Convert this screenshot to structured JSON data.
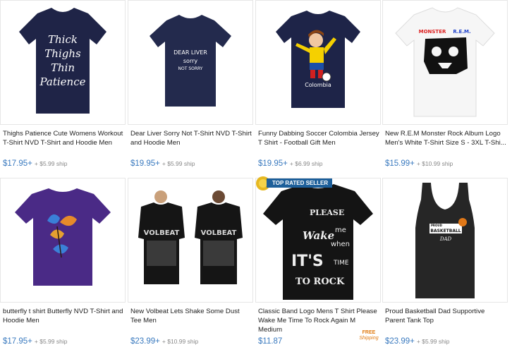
{
  "products": [
    {
      "title": "Thighs Patience Cute Womens Workout T-Shirt NVD T-Shirt and Hoodie Men",
      "price": "$17.95+",
      "ship": "+ $5.99 ship",
      "image_text": [
        "Thick",
        "Thighs",
        "Thin",
        "Patience"
      ]
    },
    {
      "title": "Dear Liver Sorry Not T-Shirt NVD T-Shirt and Hoodie Men",
      "price": "$19.95+",
      "ship": "+ $5.99 ship",
      "image_text": [
        "DEAR LIVER",
        "sorry",
        "NOT SORRY"
      ]
    },
    {
      "title": "Funny Dabbing Soccer Colombia Jersey T Shirt - Football Gift Men",
      "price": "$19.95+",
      "ship": "+ $6.99 ship",
      "image_text": [
        "Colombia"
      ]
    },
    {
      "title": "New R.E.M Monster Rock Album Logo Men's White T-Shirt Size S - 3XL T-Shi...",
      "price": "$15.99+",
      "ship": "+ $10.99 ship",
      "image_text": [
        "MONSTER",
        "R.E.M."
      ]
    },
    {
      "title": "butterfly t shirt Butterfly NVD T-Shirt and Hoodie Men",
      "price": "$17.95+",
      "ship": "+ $5.99 ship",
      "image_text": []
    },
    {
      "title": "New Volbeat Lets Shake Some Dust Tee Men",
      "price": "$23.99+",
      "ship": "+ $10.99 ship",
      "image_text": [
        "VOLBEAT",
        "VOLBEAT"
      ]
    },
    {
      "title": "Classic Band Logo Mens T Shirt Please Wake Me Time To Rock Again M Medium",
      "price": "$11.87",
      "ship": "",
      "badge": "TOP RATED SELLER",
      "free_shipping": {
        "line1": "FREE",
        "line2": "Shipping"
      },
      "image_text": [
        "PLEASE",
        "Wake",
        "me",
        "when",
        "IT'S",
        "TIME",
        "TO ROCK"
      ]
    },
    {
      "title": "Proud Basketball Dad Supportive Parent Tank Top",
      "price": "$23.99+",
      "ship": "+ $5.99 ship",
      "image_text": [
        "PROUD",
        "BASKETBALL",
        "DAD"
      ]
    }
  ],
  "colors": {
    "price": "#3a7abf",
    "ship": "#888888",
    "badge": "#1d5f9a"
  }
}
